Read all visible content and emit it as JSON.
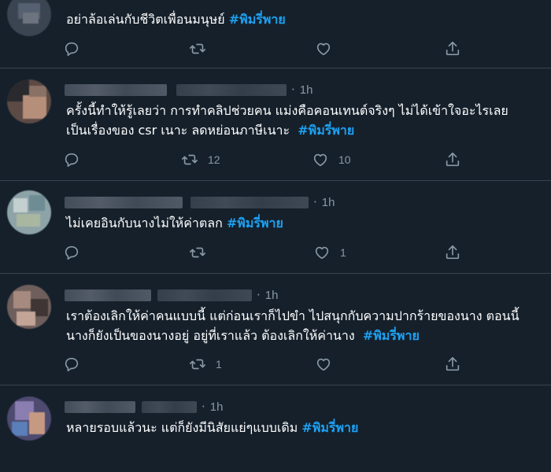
{
  "tweets": [
    {
      "time": "",
      "text": "อย่าล้อเล่นกับชีวิตเพื่อนมนุษย์",
      "hashtag": "#พิมรี่พาย",
      "line2": "",
      "line2_hashtag": "",
      "retweets": "",
      "likes": ""
    },
    {
      "time": "1h",
      "text": "ครั้งนี้ทำให้รู้เลยว่า การทำคลิปช่วยคน แม่งคือคอนเทนต์จริงๆ ไม่ได้เข้าใจอะไรเลย",
      "hashtag": "",
      "line2": "เป็นเรื่องของ csr เนาะ ลดหย่อนภาษีเนาะ",
      "line2_hashtag": "#พิมรี่พาย",
      "retweets": "12",
      "likes": "10"
    },
    {
      "time": "1h",
      "text": "ไม่เคยอินกับนางไม่ให้ค่าตลก",
      "hashtag": "#พิมรี่พาย",
      "line2": "",
      "line2_hashtag": "",
      "retweets": "",
      "likes": "1"
    },
    {
      "time": "1h",
      "text": "เราต้องเลิกให้ค่าคนแบบนี้ แต่ก่อนเราก็ไปขำ ไปสนุกกับความปากร้ายของนาง ตอนนี้",
      "hashtag": "",
      "line2": "นางก็ยังเป็นของนางอยู่ อยู่ที่เราแล้ว ต้องเลิกให้ค่านาง",
      "line2_hashtag": "#พิมรี่พาย",
      "retweets": "1",
      "likes": ""
    },
    {
      "time": "1h",
      "text": "หลายรอบแล้วนะ แต่ก็ยังมีนิสัยแย่ๆแบบเดิม",
      "hashtag": "#พิมรี่พาย",
      "line2": "",
      "line2_hashtag": "",
      "retweets": "",
      "likes": ""
    }
  ],
  "colors": {
    "background": "#15202b",
    "hashtag": "#1da1f2",
    "muted": "#8899a6",
    "divider": "#38444d"
  },
  "icons": [
    "reply-icon",
    "retweet-icon",
    "like-icon",
    "share-icon"
  ]
}
